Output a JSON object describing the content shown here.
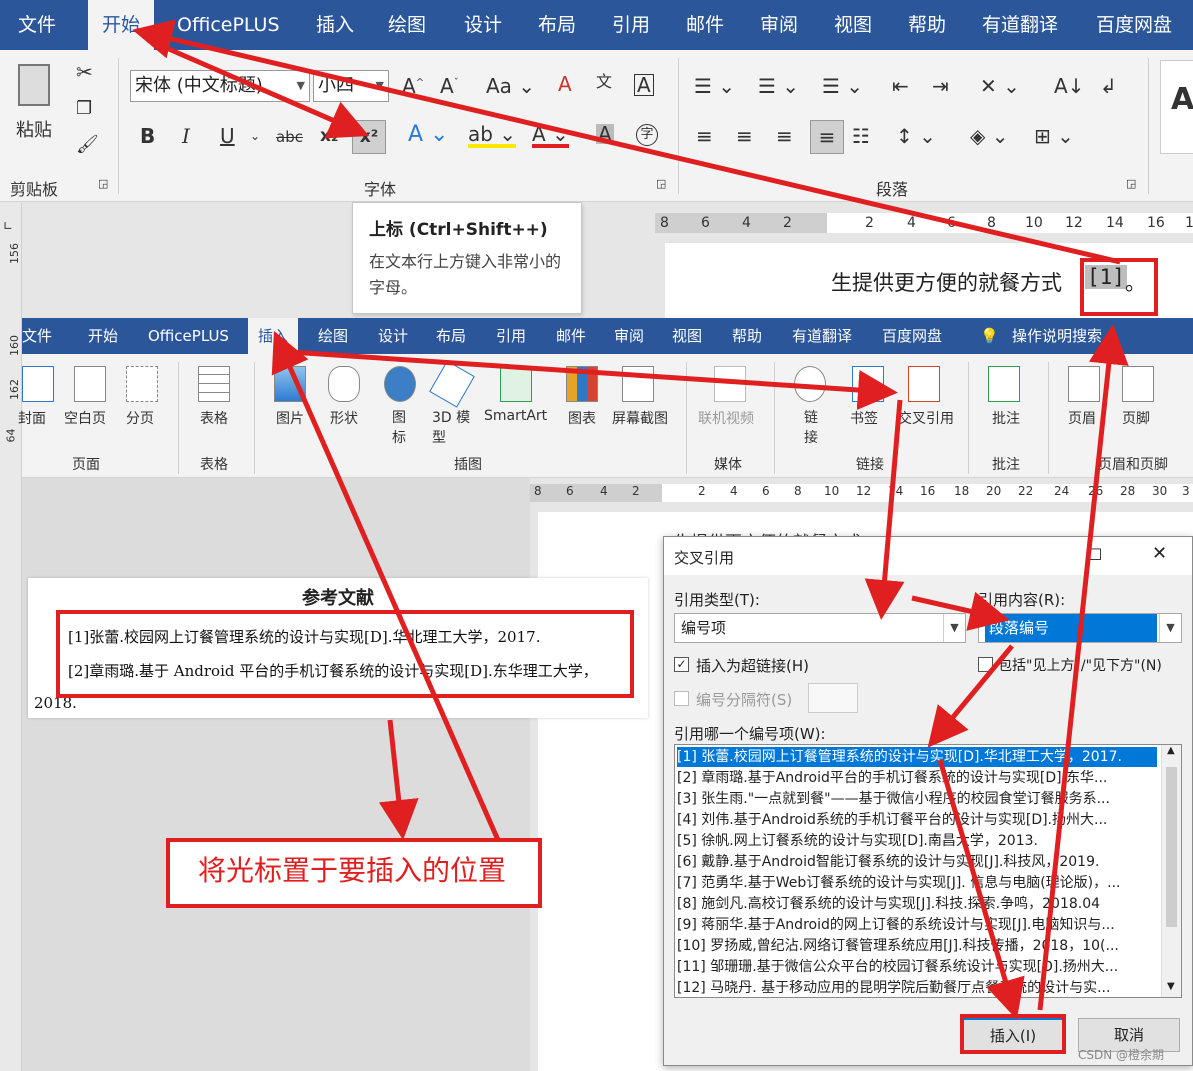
{
  "top_ribbon": {
    "tabs": [
      "文件",
      "开始",
      "OfficePLUS",
      "插入",
      "绘图",
      "设计",
      "布局",
      "引用",
      "邮件",
      "审阅",
      "视图",
      "帮助",
      "有道翻译",
      "百度网盘"
    ],
    "active_tab": "开始",
    "paste_label": "粘贴",
    "clipboard_group": "剪贴板",
    "font_group": "字体",
    "paragraph_group": "段落",
    "font_name": "宋体 (中文标题)",
    "font_size": "小四",
    "buttons": {
      "bold": "B",
      "italic": "I",
      "underline": "U",
      "strike": "abc",
      "subscript": "x₂",
      "superscript": "x²"
    }
  },
  "tooltip": {
    "title": "上标 (Ctrl+Shift++)",
    "desc": "在文本行上方键入非常小的字母。"
  },
  "ruler_top": [
    "8",
    "6",
    "4",
    "2",
    "2",
    "4",
    "6",
    "8",
    "10",
    "12",
    "14",
    "16",
    "1"
  ],
  "doc_top": {
    "text": "生提供更方便的就餐方式",
    "citation": "[1]",
    "tail": "。"
  },
  "second_ribbon": {
    "tabs": [
      "文件",
      "开始",
      "OfficePLUS",
      "插入",
      "绘图",
      "设计",
      "布局",
      "引用",
      "邮件",
      "审阅",
      "视图",
      "帮助",
      "有道翻译",
      "百度网盘",
      "操作说明搜索"
    ],
    "active_tab": "插入",
    "items": [
      "封面",
      "空白页",
      "分页",
      "表格",
      "图片",
      "形状",
      "图标",
      "3D 模型",
      "SmartArt",
      "图表",
      "屏幕截图",
      "联机视频",
      "链接",
      "书签",
      "交叉引用",
      "批注",
      "页眉",
      "页脚"
    ],
    "groups": [
      "页面",
      "表格",
      "插图",
      "媒体",
      "链接",
      "批注",
      "页眉和页脚"
    ]
  },
  "ruler_second": [
    "8",
    "6",
    "4",
    "2",
    "2",
    "4",
    "6",
    "8",
    "10",
    "12",
    "14",
    "16",
    "18",
    "20",
    "22",
    "24",
    "26",
    "28",
    "30",
    "3"
  ],
  "left_ruler": [
    "156",
    "160",
    "162",
    "64"
  ],
  "page2_text": "生提供更方便的就餐方式",
  "references": {
    "title": "参考文献",
    "lines": [
      "[1]张蕾.校园网上订餐管理系统的设计与实现[D].华北理工大学，2017.",
      "[2]章雨璐.基于 Android 平台的手机订餐系统的设计与实现[D].东华理工大学，",
      "2018."
    ]
  },
  "callout": "将光标置于要插入的位置",
  "dialog": {
    "title": "交叉引用",
    "ref_type_label": "引用类型(T):",
    "ref_type_value": "编号项",
    "ref_content_label": "引用内容(R):",
    "ref_content_value": "段落编号",
    "hyperlink_label": "插入为超链接(H)",
    "include_label": "包括\"见上方\"/\"见下方\"(N)",
    "separator_label": "编号分隔符(S)",
    "which_label": "引用哪一个编号项(W):",
    "items": [
      "[1] 张蕾.校园网上订餐管理系统的设计与实现[D].华北理工大学，2017.",
      "[2] 章雨璐.基于Android平台的手机订餐系统的设计与实现[D].东华...",
      "[3] 张生雨.\"一点就到餐\"——基于微信小程序的校园食堂订餐服务系...",
      "[4] 刘伟.基于Android系统的手机订餐平台的设计与实现[D].扬州大...",
      "[5] 徐帆.网上订餐系统的设计与实现[D].南昌大学，2013.",
      "[6] 戴静.基于Android智能订餐系统的设计与实现[J].科技风，2019.",
      "[7] 范勇华.基于Web订餐系统的设计与实现[J]. 信息与电脑(理论版)，...",
      "[8] 施剑凡.高校订餐系统的设计与实现[J].科技.探索.争鸣，2018.04",
      "[9] 蒋丽华.基于Android的网上订餐的系统设计与实现[J].电脑知识与...",
      "[10] 罗扬威,曾纪沾.网络订餐管理系统应用[J].科技传播，2018，10(...",
      "[11] 邹珊珊.基于微信公众平台的校园订餐系统设计与实现[D].扬州大...",
      "[12] 马晓丹. 基于移动应用的昆明学院后勤餐厅点餐系统的设计与实..."
    ],
    "insert_button": "插入(I)",
    "cancel_button": "取消"
  },
  "watermark": "CSDN @橙余期",
  "colors": {
    "ribbon_blue": "#2b579a",
    "annotation_red": "#e02020",
    "selection": "#0078d7"
  }
}
